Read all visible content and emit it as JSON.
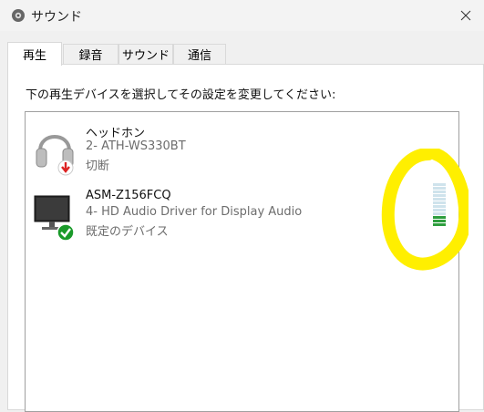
{
  "window": {
    "title": "サウンド"
  },
  "tabs": [
    {
      "label": "再生",
      "active": true
    },
    {
      "label": "録音",
      "active": false
    },
    {
      "label": "サウンド",
      "active": false
    },
    {
      "label": "通信",
      "active": false
    }
  ],
  "instruction": "下の再生デバイスを選択してその設定を変更してください:",
  "devices": [
    {
      "name": "ヘッドホン",
      "desc": "2- ATH-WS330BT",
      "status": "切断",
      "icon": "headphones-icon",
      "badge": "disconnected-arrow-icon"
    },
    {
      "name": "ASM-Z156FCQ",
      "desc": "4- HD Audio Driver for Display Audio",
      "status": "既定のデバイス",
      "icon": "monitor-icon",
      "badge": "default-check-icon"
    }
  ],
  "level_meter": {
    "level": 0.25,
    "segments": 12,
    "active_color": "#2e9e3e",
    "inactive_color": "#cfe3ec"
  },
  "colors": {
    "highlight": "#ffef00",
    "check": "#1a9a2a",
    "arrow": "#d22"
  }
}
